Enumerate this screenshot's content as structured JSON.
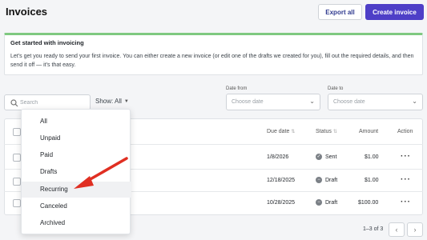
{
  "header": {
    "title": "Invoices",
    "export_label": "Export all",
    "create_label": "Create invoice"
  },
  "banner": {
    "title": "Get started with invoicing",
    "text": "Let’s get you ready to send your first invoice. You can either create a new invoice (or edit one of the drafts we created for you), fill out the required details, and then send it off — it’s that easy."
  },
  "filters": {
    "search_placeholder": "Search",
    "show_label": "Show: All",
    "date_from_label": "Date from",
    "date_to_label": "Date to",
    "date_placeholder": "Choose date"
  },
  "table": {
    "columns": {
      "due_date": "Due date",
      "status": "Status",
      "amount": "Amount",
      "action": "Action"
    },
    "rows": [
      {
        "due_date": "1/8/2026",
        "status": "Sent",
        "amount": "$1.00"
      },
      {
        "due_date": "12/18/2025",
        "status": "Draft",
        "amount": "$1.00"
      },
      {
        "due_date": "10/28/2025",
        "status": "Draft",
        "amount": "$100.00"
      }
    ]
  },
  "pagination": {
    "text": "1–3 of 3"
  },
  "dropdown": {
    "items": [
      "All",
      "Unpaid",
      "Paid",
      "Drafts",
      "Recurring",
      "Canceled",
      "Archived"
    ],
    "highlighted": "Recurring"
  },
  "colors": {
    "accent": "#4e3fc7",
    "banner_border": "#7fc980",
    "arrow": "#e02f22"
  }
}
